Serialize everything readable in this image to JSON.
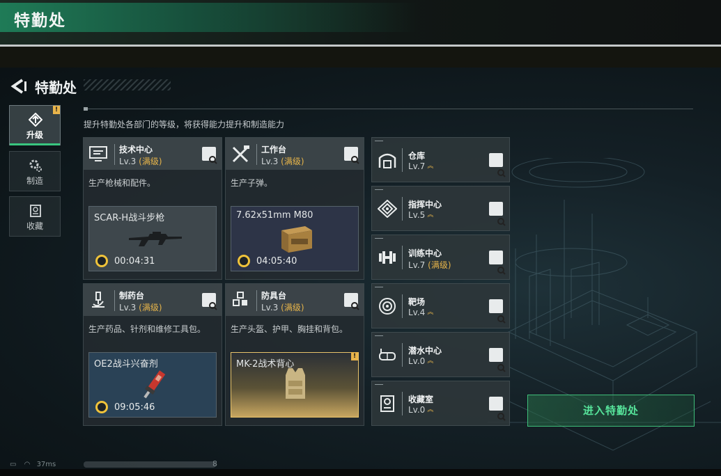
{
  "window": {
    "title": "特勤处"
  },
  "page": {
    "title": "特勤处",
    "description": "提升特勤处各部门的等级，将获得能力提升和制造能力",
    "enter_button": "进入特勤处"
  },
  "nav": [
    {
      "label": "升级",
      "icon": "upgrade-icon",
      "active": true,
      "badge": "!"
    },
    {
      "label": "制造",
      "icon": "gears-icon",
      "active": false
    },
    {
      "label": "收藏",
      "icon": "collection-icon",
      "active": false
    }
  ],
  "departments": [
    {
      "name": "技术中心",
      "level": "Lv.3",
      "max_label": "(满级)",
      "description": "生产枪械和配件。",
      "product": {
        "name": "SCAR-H战斗步枪",
        "timer": "00:04:31"
      }
    },
    {
      "name": "工作台",
      "level": "Lv.3",
      "max_label": "(满级)",
      "description": "生产子弹。",
      "product": {
        "name": "7.62x51mm M80",
        "timer": "04:05:40"
      }
    },
    {
      "name": "制药台",
      "level": "Lv.3",
      "max_label": "(满级)",
      "description": "生产药品、针剂和维修工具包。",
      "product": {
        "name": "OE2战斗兴奋剂",
        "timer": "09:05:46"
      }
    },
    {
      "name": "防具台",
      "level": "Lv.3",
      "max_label": "(满级)",
      "description": "生产头盔、护甲、胸挂和背包。",
      "product": {
        "name": "MK-2战术背心",
        "badge": "!"
      }
    }
  ],
  "facilities": [
    {
      "name": "仓库",
      "level": "Lv.7",
      "max_label": "",
      "upgradable": true
    },
    {
      "name": "指挥中心",
      "level": "Lv.5",
      "max_label": "",
      "upgradable": true
    },
    {
      "name": "训练中心",
      "level": "Lv.7",
      "max_label": "(满级)",
      "upgradable": false
    },
    {
      "name": "靶场",
      "level": "Lv.4",
      "max_label": "",
      "upgradable": true
    },
    {
      "name": "潜水中心",
      "level": "Lv.0",
      "max_label": "",
      "upgradable": true
    },
    {
      "name": "收藏室",
      "level": "Lv.0",
      "max_label": "",
      "upgradable": true
    }
  ],
  "status_bar": {
    "ping": "37ms",
    "trailing": "8"
  },
  "colors": {
    "accent_green": "#39c57f",
    "max_gold": "#e6b44a",
    "rare_gold": "#e9c46a"
  }
}
